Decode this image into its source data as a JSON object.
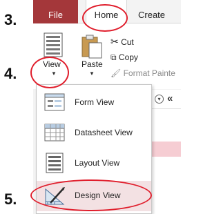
{
  "annotations": {
    "step3": "3.",
    "step4": "4.",
    "step5": "5.",
    "oval_color": "#e01e2c"
  },
  "tabs": {
    "file": "File",
    "home": "Home",
    "create": "Create"
  },
  "ribbon": {
    "view_label": "View",
    "paste_label": "Paste",
    "cut_label": "Cut",
    "copy_label": "Copy",
    "format_painter_label": "Format Painte"
  },
  "view_menu": {
    "items": [
      {
        "label": "Form View",
        "icon": "form-view-icon"
      },
      {
        "label": "Datasheet View",
        "icon": "datasheet-view-icon"
      },
      {
        "label": "Layout View",
        "icon": "layout-view-icon"
      },
      {
        "label": "Design View",
        "icon": "design-view-icon"
      }
    ]
  },
  "colors": {
    "file_tab": "#a4373a",
    "accent_pink": "#f6cdd3"
  }
}
